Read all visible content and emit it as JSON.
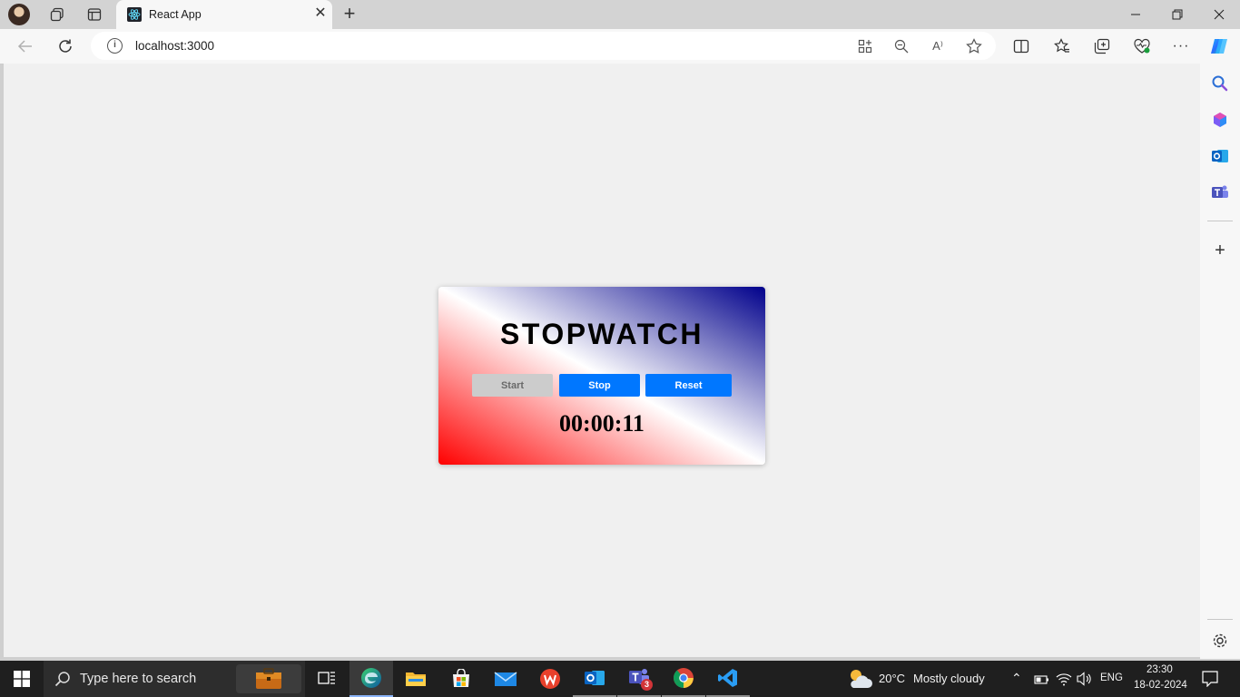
{
  "browser": {
    "tab_title": "React App",
    "url": "localhost:3000"
  },
  "stopwatch": {
    "title": "STOPWATCH",
    "start_label": "Start",
    "stop_label": "Stop",
    "reset_label": "Reset",
    "time": "00:00:11"
  },
  "taskbar": {
    "search_placeholder": "Type here to search",
    "weather_temp": "20°C",
    "weather_desc": "Mostly cloudy",
    "teams_badge": "3",
    "language": "ENG",
    "time": "23:30",
    "date": "18-02-2024"
  },
  "colors": {
    "accent_blue": "#0077ff",
    "card_gradient_start": "#ff0000",
    "card_gradient_end": "#00008b"
  }
}
